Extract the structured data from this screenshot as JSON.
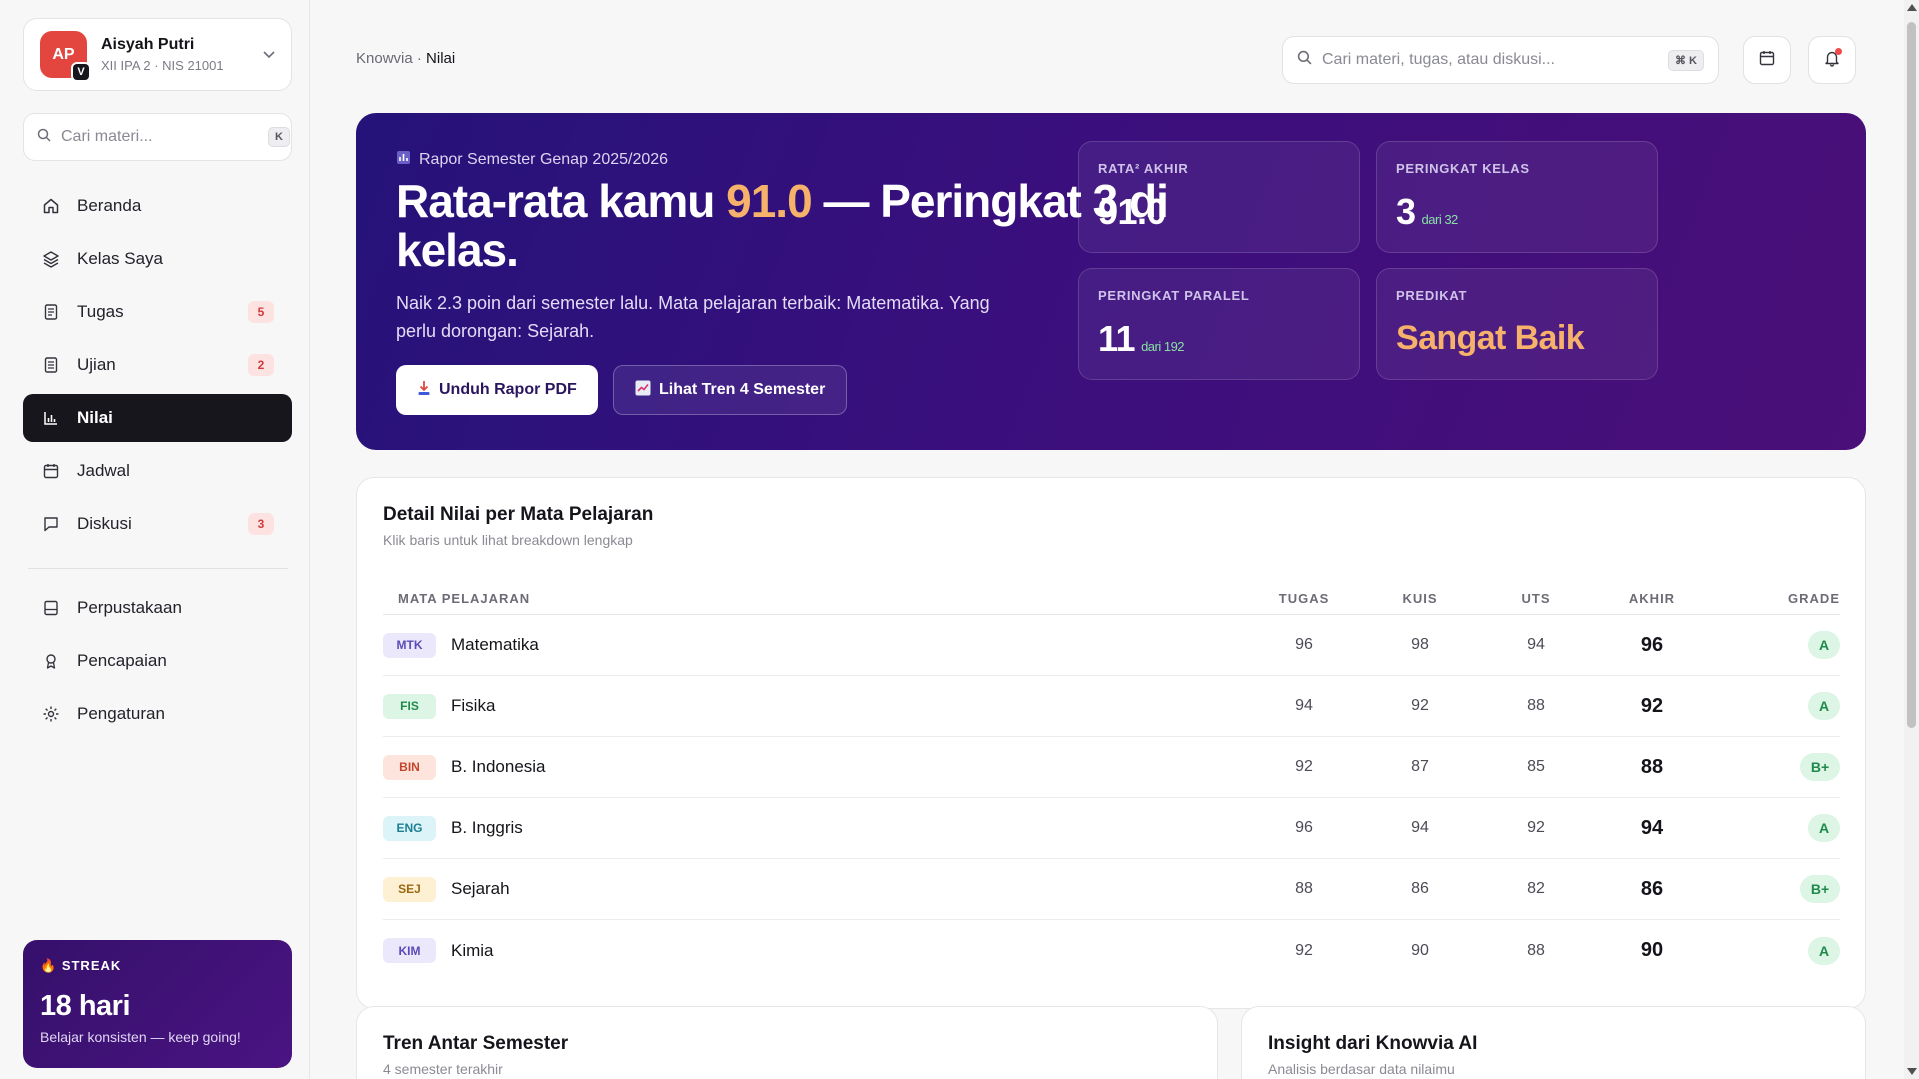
{
  "profile": {
    "initials": "AP",
    "badge": "V",
    "name": "Aisyah Putri",
    "sub": "XII IPA 2 · NIS 21001"
  },
  "sidebar_search": {
    "placeholder": "Cari materi...",
    "shortcut": "K"
  },
  "nav": [
    {
      "label": "Beranda",
      "icon": "home-icon",
      "count": ""
    },
    {
      "label": "Kelas Saya",
      "icon": "layers-icon",
      "count": ""
    },
    {
      "label": "Tugas",
      "icon": "document-icon",
      "count": "5"
    },
    {
      "label": "Ujian",
      "icon": "checklist-icon",
      "count": "2"
    },
    {
      "label": "Nilai",
      "icon": "bar-chart-icon",
      "count": "",
      "active": true
    },
    {
      "label": "Jadwal",
      "icon": "calendar-icon",
      "count": ""
    },
    {
      "label": "Diskusi",
      "icon": "chat-icon",
      "count": "3"
    }
  ],
  "nav2": [
    {
      "label": "Perpustakaan",
      "icon": "book-icon"
    },
    {
      "label": "Pencapaian",
      "icon": "award-icon"
    },
    {
      "label": "Pengaturan",
      "icon": "gear-icon"
    }
  ],
  "streak": {
    "label": "STREAK",
    "value": "18 hari",
    "sub": "Belajar konsisten — keep going!"
  },
  "breadcrumb": {
    "root": "Knowvia",
    "sep": " · ",
    "current": "Nilai"
  },
  "top_search": {
    "placeholder": "Cari materi, tugas, atau diskusi...",
    "shortcut": "⌘ K"
  },
  "hero": {
    "label": "Rapor Semester Genap 2025/2026",
    "title_pre": "Rata-rata kamu ",
    "title_highlight": "91.0",
    "title_post": " — Peringkat 3 di kelas.",
    "desc": "Naik 2.3 poin dari semester lalu. Mata pelajaran terbaik: Matematika. Yang perlu dorongan: Sejarah.",
    "btn_download": "Unduh Rapor PDF",
    "btn_trend": "Lihat Tren 4 Semester"
  },
  "stats": [
    {
      "label": "RATA² AKHIR",
      "value": "91.0",
      "sub": ""
    },
    {
      "label": "PERINGKAT KELAS",
      "value": "3",
      "sub": "dari 32"
    },
    {
      "label": "PERINGKAT PARALEL",
      "value": "11",
      "sub": "dari 192"
    },
    {
      "label": "PREDIKAT",
      "value": "Sangat Baik",
      "sub": ""
    }
  ],
  "detail": {
    "title": "Detail Nilai per Mata Pelajaran",
    "sub": "Klik baris untuk lihat breakdown lengkap",
    "headers": [
      "MATA PELAJARAN",
      "TUGAS",
      "KUIS",
      "UTS",
      "AKHIR",
      "GRADE"
    ],
    "rows": [
      {
        "code": "MTK",
        "name": "Matematika",
        "tugas": "96",
        "kuis": "98",
        "uts": "94",
        "akhir": "96",
        "grade": "A",
        "tag_bg": "#ebe8fb",
        "tag_fg": "#5a4bb8"
      },
      {
        "code": "FIS",
        "name": "Fisika",
        "tugas": "94",
        "kuis": "92",
        "uts": "88",
        "akhir": "92",
        "grade": "A",
        "tag_bg": "#dcf5e4",
        "tag_fg": "#1f8a4c"
      },
      {
        "code": "BIN",
        "name": "B. Indonesia",
        "tugas": "92",
        "kuis": "87",
        "uts": "85",
        "akhir": "88",
        "grade": "B+",
        "tag_bg": "#fde4dc",
        "tag_fg": "#c2452b"
      },
      {
        "code": "ENG",
        "name": "B. Inggris",
        "tugas": "96",
        "kuis": "94",
        "uts": "92",
        "akhir": "94",
        "grade": "A",
        "tag_bg": "#dcf3f7",
        "tag_fg": "#1d7f93"
      },
      {
        "code": "SEJ",
        "name": "Sejarah",
        "tugas": "88",
        "kuis": "86",
        "uts": "82",
        "akhir": "86",
        "grade": "B+",
        "tag_bg": "#fdf0d3",
        "tag_fg": "#9a6a12"
      },
      {
        "code": "KIM",
        "name": "Kimia",
        "tugas": "92",
        "kuis": "90",
        "uts": "88",
        "akhir": "90",
        "grade": "A",
        "tag_bg": "#ebe8fb",
        "tag_fg": "#5a4bb8"
      }
    ]
  },
  "trend_card": {
    "title": "Tren Antar Semester",
    "sub": "4 semester terakhir"
  },
  "insight_card": {
    "title": "Insight dari Knowvia AI",
    "sub": "Analisis berdasar data nilaimu"
  },
  "colors": {
    "accent": "#3a0f7d",
    "highlight": "#f6b26b",
    "active_nav": "#16161c"
  }
}
